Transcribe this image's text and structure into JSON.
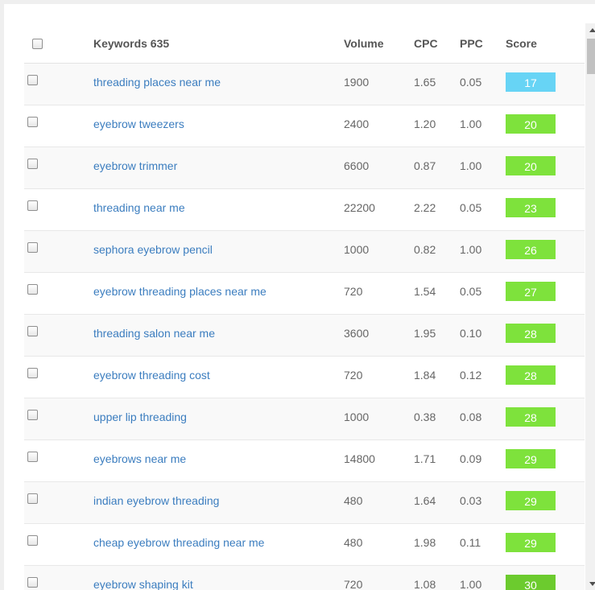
{
  "colors": {
    "link": "#3b7dbf",
    "score_blue": "#67d4f5",
    "score_green": "#7ee23c",
    "score_dark_green": "#6ccb2e"
  },
  "table": {
    "header": {
      "keywords": "Keywords 635",
      "volume": "Volume",
      "cpc": "CPC",
      "ppc": "PPC",
      "score": "Score"
    },
    "rows": [
      {
        "keyword": "threading places near me",
        "volume": "1900",
        "cpc": "1.65",
        "ppc": "0.05",
        "score": "17",
        "score_color": "#67d4f5"
      },
      {
        "keyword": "eyebrow tweezers",
        "volume": "2400",
        "cpc": "1.20",
        "ppc": "1.00",
        "score": "20",
        "score_color": "#7ee23c"
      },
      {
        "keyword": "eyebrow trimmer",
        "volume": "6600",
        "cpc": "0.87",
        "ppc": "1.00",
        "score": "20",
        "score_color": "#7ee23c"
      },
      {
        "keyword": "threading near me",
        "volume": "22200",
        "cpc": "2.22",
        "ppc": "0.05",
        "score": "23",
        "score_color": "#7ee23c"
      },
      {
        "keyword": "sephora eyebrow pencil",
        "volume": "1000",
        "cpc": "0.82",
        "ppc": "1.00",
        "score": "26",
        "score_color": "#7ee23c"
      },
      {
        "keyword": "eyebrow threading places near me",
        "volume": "720",
        "cpc": "1.54",
        "ppc": "0.05",
        "score": "27",
        "score_color": "#7ee23c"
      },
      {
        "keyword": "threading salon near me",
        "volume": "3600",
        "cpc": "1.95",
        "ppc": "0.10",
        "score": "28",
        "score_color": "#7ee23c"
      },
      {
        "keyword": "eyebrow threading cost",
        "volume": "720",
        "cpc": "1.84",
        "ppc": "0.12",
        "score": "28",
        "score_color": "#7ee23c"
      },
      {
        "keyword": "upper lip threading",
        "volume": "1000",
        "cpc": "0.38",
        "ppc": "0.08",
        "score": "28",
        "score_color": "#7ee23c"
      },
      {
        "keyword": "eyebrows near me",
        "volume": "14800",
        "cpc": "1.71",
        "ppc": "0.09",
        "score": "29",
        "score_color": "#7ee23c"
      },
      {
        "keyword": "indian eyebrow threading",
        "volume": "480",
        "cpc": "1.64",
        "ppc": "0.03",
        "score": "29",
        "score_color": "#7ee23c"
      },
      {
        "keyword": "cheap eyebrow threading near me",
        "volume": "480",
        "cpc": "1.98",
        "ppc": "0.11",
        "score": "29",
        "score_color": "#7ee23c"
      },
      {
        "keyword": "eyebrow shaping kit",
        "volume": "720",
        "cpc": "1.08",
        "ppc": "1.00",
        "score": "30",
        "score_color": "#6ccb2e"
      }
    ]
  }
}
